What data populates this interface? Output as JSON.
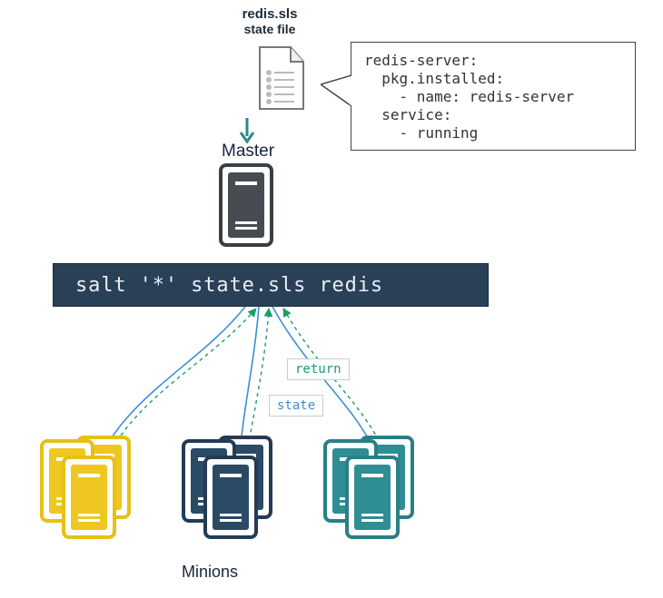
{
  "caption": {
    "line1": "redis.sls",
    "line2": "state file"
  },
  "code": "redis-server:\n  pkg.installed:\n    - name: redis-server\n  service:\n    - running",
  "master_label": "Master",
  "command": "salt '*' state.sls redis",
  "tag_return": "return",
  "tag_state": "state",
  "minions_label": "Minions",
  "icons": {
    "document": "document-icon",
    "arrow": "down-arrow-icon",
    "server": "server-icon",
    "cluster_yellow": "server-cluster-yellow",
    "cluster_navy": "server-cluster-navy",
    "cluster_teal": "server-cluster-teal"
  }
}
